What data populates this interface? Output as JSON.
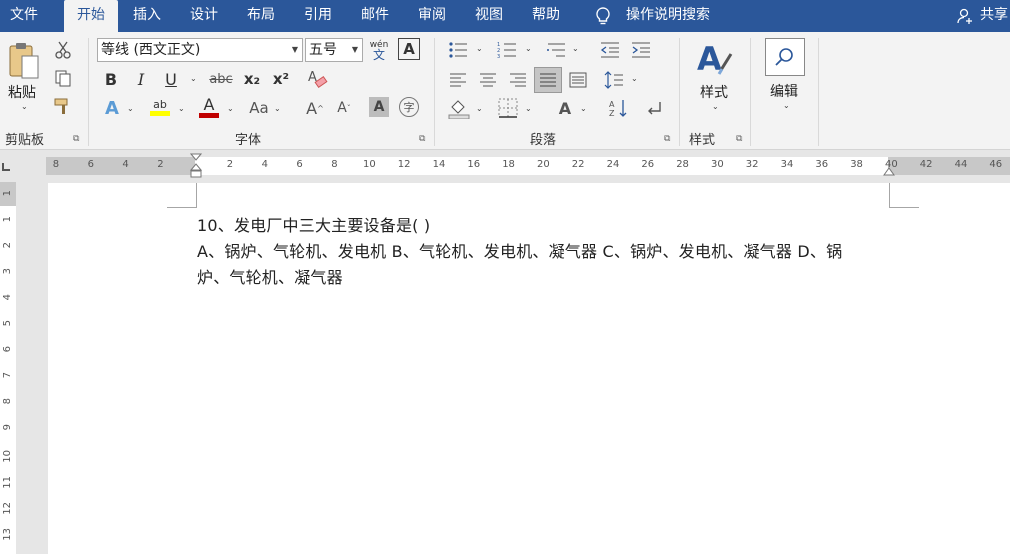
{
  "tabs": [
    {
      "label": "文件",
      "active": false
    },
    {
      "label": "开始",
      "active": true
    },
    {
      "label": "插入",
      "active": false
    },
    {
      "label": "设计",
      "active": false
    },
    {
      "label": "布局",
      "active": false
    },
    {
      "label": "引用",
      "active": false
    },
    {
      "label": "邮件",
      "active": false
    },
    {
      "label": "审阅",
      "active": false
    },
    {
      "label": "视图",
      "active": false
    },
    {
      "label": "帮助",
      "active": false
    }
  ],
  "tell_me": "操作说明搜索",
  "share": "共享",
  "ribbon": {
    "clipboard": {
      "paste": "粘贴",
      "label": "剪贴板"
    },
    "font": {
      "name": "等线 (西文正文)",
      "size": "五号",
      "phonetic": "wén",
      "phonetic_char": "文",
      "label": "字体",
      "bold": "B",
      "italic": "I",
      "underline": "U",
      "strike": "abc",
      "subscript": "x₂",
      "superscript": "x²",
      "case": "Aa",
      "grow": "A",
      "shrink": "A",
      "shade": "A",
      "enclose": "字"
    },
    "paragraph": {
      "label": "段落"
    },
    "styles": {
      "button": "样式",
      "label": "样式"
    },
    "editing": {
      "button": "编辑"
    }
  },
  "ruler": {
    "left_numbers": [
      "8",
      "6",
      "4",
      "2"
    ],
    "right_numbers": [
      "2",
      "4",
      "6",
      "8",
      "10",
      "12",
      "14",
      "16",
      "18",
      "20",
      "22",
      "24",
      "26",
      "28",
      "30",
      "32",
      "34",
      "36",
      "38",
      "40",
      "42",
      "44",
      "46"
    ],
    "vertical_numbers": [
      "1",
      "1",
      "2",
      "3",
      "4",
      "5",
      "6",
      "7",
      "8",
      "9",
      "10",
      "11",
      "12",
      "13"
    ]
  },
  "document": {
    "lines": [
      "10、发电厂中三大主要设备是( )",
      "A、锅炉、气轮机、发电机 B、气轮机、发电机、凝气器 C、锅炉、发电机、凝气器 D、锅",
      "炉、气轮机、凝气器"
    ]
  },
  "colors": {
    "titlebar": "#2b579a",
    "ribbon": "#f3f3f3",
    "highlight": "#ffff00",
    "font_color": "#c00000"
  }
}
